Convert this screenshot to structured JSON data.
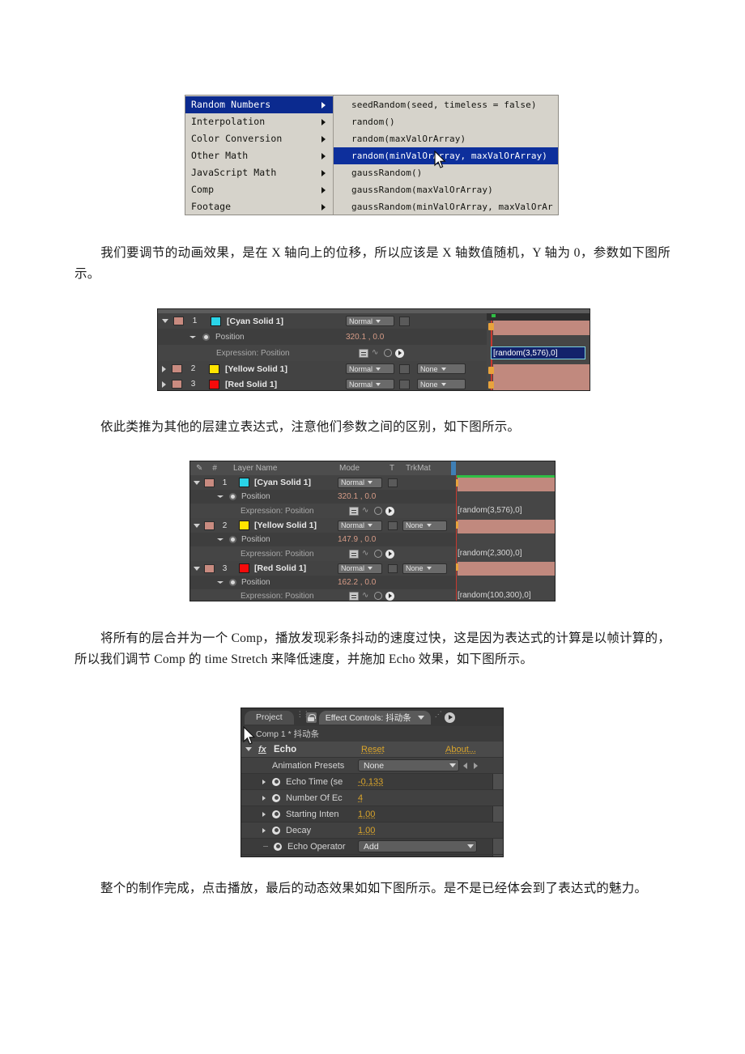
{
  "document": {
    "paragraphs": [
      {
        "id": "p1",
        "text": "我们要调节的动画效果，是在 X 轴向上的位移，所以应该是 X 轴数值随机，Y 轴为 0，参数如下图所示。"
      },
      {
        "id": "p2",
        "text": "依此类推为其他的层建立表达式，注意他们参数之间的区别，如下图所示。"
      },
      {
        "id": "p3",
        "text": "将所有的层合并为一个 Comp，播放发现彩条抖动的速度过快，这是因为表达式的计算是以帧计算的，所以我们调节 Comp 的 time Stretch 来降低速度，并施加 Echo 效果，如下图所示。"
      },
      {
        "id": "p4",
        "text": "整个的制作完成，点击播放，最后的动态效果如如下图所示。是不是已经体会到了表达式的魅力。"
      }
    ]
  },
  "expression_menu": {
    "categories": [
      {
        "label": "Random Numbers",
        "selected": true
      },
      {
        "label": "Interpolation",
        "selected": false
      },
      {
        "label": "Color Conversion",
        "selected": false
      },
      {
        "label": "Other Math",
        "selected": false
      },
      {
        "label": "JavaScript Math",
        "selected": false
      },
      {
        "label": "Comp",
        "selected": false
      },
      {
        "label": "Footage",
        "selected": false
      }
    ],
    "functions": [
      {
        "label": "seedRandom(seed, timeless = false)",
        "selected": false
      },
      {
        "label": "random()",
        "selected": false
      },
      {
        "label": "random(maxValOrArray)",
        "selected": false
      },
      {
        "label": "random(minValOrArray, maxValOrArray)",
        "selected": true
      },
      {
        "label": "gaussRandom()",
        "selected": false
      },
      {
        "label": "gaussRandom(maxValOrArray)",
        "selected": false
      },
      {
        "label": "gaussRandom(minValOrArray, maxValOrAr",
        "selected": false
      }
    ],
    "colors": {
      "background": "#d6d3cb",
      "highlight": "#0b2a8f",
      "highlight_text": "#ffffff",
      "text": "#13130f"
    }
  },
  "timeline_single": {
    "rows": [
      {
        "kind": "layer",
        "index": "1",
        "name": "[Cyan Solid 1]",
        "swatch": "#2ad4e8",
        "mode": "Normal",
        "trkmat": "",
        "has_trkmat": false
      },
      {
        "kind": "property",
        "name": "Position",
        "value": "320.1 , 0.0"
      },
      {
        "kind": "expression",
        "name": "Expression: Position",
        "expression": "[random(3,576),0]",
        "editing": true
      },
      {
        "kind": "layer",
        "index": "2",
        "name": "[Yellow Solid 1]",
        "swatch": "#ffe400",
        "mode": "Normal",
        "trkmat": "None",
        "has_trkmat": true
      },
      {
        "kind": "layer",
        "index": "3",
        "name": "[Red Solid 1]",
        "swatch": "#f60b0b",
        "mode": "Normal",
        "trkmat": "None",
        "has_trkmat": true
      }
    ]
  },
  "timeline_all": {
    "headers": {
      "eye": "✎",
      "hash": "#",
      "layer_name": "Layer Name",
      "mode": "Mode",
      "t": "T",
      "trkmat": "TrkMat"
    },
    "rows": [
      {
        "kind": "layer",
        "index": "1",
        "name": "[Cyan Solid 1]",
        "swatch": "#2ad4e8",
        "mode": "Normal",
        "trkmat": "",
        "has_trkmat": false
      },
      {
        "kind": "property",
        "name": "Position",
        "value": "320.1 , 0.0"
      },
      {
        "kind": "expression",
        "name": "Expression: Position",
        "expression": "[random(3,576),0]"
      },
      {
        "kind": "layer",
        "index": "2",
        "name": "[Yellow Solid 1]",
        "swatch": "#ffe400",
        "mode": "Normal",
        "trkmat": "None",
        "has_trkmat": true
      },
      {
        "kind": "property",
        "name": "Position",
        "value": "147.9 , 0.0"
      },
      {
        "kind": "expression",
        "name": "Expression: Position",
        "expression": "[random(2,300),0]"
      },
      {
        "kind": "layer",
        "index": "3",
        "name": "[Red Solid 1]",
        "swatch": "#f60b0b",
        "mode": "Normal",
        "trkmat": "None",
        "has_trkmat": true
      },
      {
        "kind": "property",
        "name": "Position",
        "value": "162.2 , 0.0"
      },
      {
        "kind": "expression",
        "name": "Expression: Position",
        "expression": "[random(100,300),0]"
      }
    ]
  },
  "effect_controls": {
    "tabs": [
      {
        "label": "Project",
        "active": false
      },
      {
        "label": "Effect Controls: 抖动条",
        "active": true
      }
    ],
    "subtitle": "Comp 1 * 抖动条",
    "effect": {
      "name": "Echo",
      "reset_label": "Reset",
      "about_label": "About...",
      "params": [
        {
          "name": "Animation Presets",
          "type": "dropdown",
          "value": "None"
        },
        {
          "name": "Echo Time (se",
          "type": "value",
          "value": "-0.133"
        },
        {
          "name": "Number Of Ec",
          "type": "value",
          "value": "4"
        },
        {
          "name": "Starting Inten",
          "type": "value",
          "value": "1.00"
        },
        {
          "name": "Decay",
          "type": "value",
          "value": "1.00"
        },
        {
          "name": "Echo Operator",
          "type": "dropdown",
          "value": "Add"
        }
      ]
    }
  }
}
